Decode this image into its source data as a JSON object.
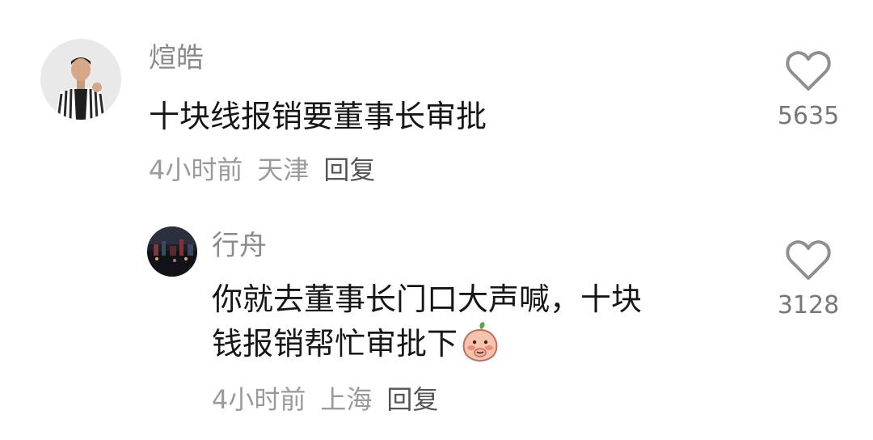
{
  "comments": [
    {
      "username": "煊皓",
      "content": "十块线报销要董事长审批",
      "time": "4小时前",
      "location": "天津",
      "reply_label": "回复",
      "like_count": "5635"
    },
    {
      "username": "行舟",
      "content_line1": "你就去董事长门口大声喊，十块",
      "content_line2": "钱报销帮忙审批下",
      "time": "4小时前",
      "location": "上海",
      "reply_label": "回复",
      "like_count": "3128"
    }
  ],
  "colors": {
    "username": "#8a8a8a",
    "content": "#161616",
    "meta": "#9a9a9a",
    "icon": "#8f8f8f"
  },
  "icons": {
    "like": "heart-outline-icon",
    "emoji": "blushing-peach-emoji-icon"
  }
}
